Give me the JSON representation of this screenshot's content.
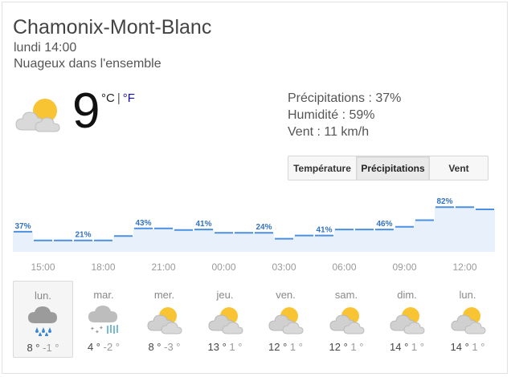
{
  "location": {
    "name": "Chamonix-Mont-Blanc",
    "time": "lundi 14:00",
    "condition": "Nuageux dans l'ensemble"
  },
  "current": {
    "icon": "partly-cloudy-icon",
    "temp": "9",
    "unit_c": "°C",
    "unit_sep": "|",
    "unit_f": "°F"
  },
  "details": {
    "precip": "Précipitations : 37%",
    "humidity": "Humidité : 59%",
    "wind": "Vent : 11 km/h"
  },
  "tabs": [
    {
      "label": "Température",
      "active": false
    },
    {
      "label": "Précipitations",
      "active": true
    },
    {
      "label": "Vent",
      "active": false
    }
  ],
  "colors": {
    "line": "#4a90e2",
    "fill": "#e8f1fb",
    "label": "#3372c2",
    "axis": "#9a9a9a"
  },
  "chart_data": {
    "type": "area",
    "ylabel": "Précipitations (%)",
    "x": [
      "14:00",
      "15:00",
      "16:00",
      "17:00",
      "18:00",
      "19:00",
      "20:00",
      "21:00",
      "22:00",
      "23:00",
      "00:00",
      "01:00",
      "02:00",
      "03:00",
      "04:00",
      "05:00",
      "06:00",
      "07:00",
      "08:00",
      "09:00",
      "10:00",
      "11:00",
      "12:00",
      "13:00"
    ],
    "values": [
      37,
      21,
      21,
      21,
      21,
      29,
      43,
      43,
      40,
      41,
      35,
      35,
      35,
      24,
      30,
      30,
      41,
      41,
      41,
      46,
      58,
      82,
      82,
      78
    ],
    "labeled_points": [
      {
        "index": 0,
        "text": "37%"
      },
      {
        "index": 3,
        "text": "21%"
      },
      {
        "index": 6,
        "text": "43%"
      },
      {
        "index": 9,
        "text": "41%"
      },
      {
        "index": 12,
        "text": "24%"
      },
      {
        "index": 15,
        "text": "41%"
      },
      {
        "index": 18,
        "text": "46%"
      },
      {
        "index": 21,
        "text": "82%"
      }
    ],
    "tick_labels": [
      "15:00",
      "18:00",
      "21:00",
      "00:00",
      "03:00",
      "06:00",
      "09:00",
      "12:00"
    ],
    "ylim": [
      0,
      100
    ]
  },
  "forecast": [
    {
      "day": "lun.",
      "icon": "rain-icon",
      "hi": "8 °",
      "lo": "-1 °",
      "selected": true
    },
    {
      "day": "mar.",
      "icon": "rain-snow-icon",
      "hi": "4 °",
      "lo": "-2 °",
      "selected": false
    },
    {
      "day": "mer.",
      "icon": "partly-cloudy-icon",
      "hi": "8 °",
      "lo": "-3 °",
      "selected": false
    },
    {
      "day": "jeu.",
      "icon": "partly-cloudy-icon",
      "hi": "13 °",
      "lo": "1 °",
      "selected": false
    },
    {
      "day": "ven.",
      "icon": "partly-cloudy-icon",
      "hi": "12 °",
      "lo": "1 °",
      "selected": false
    },
    {
      "day": "sam.",
      "icon": "partly-cloudy-icon",
      "hi": "12 °",
      "lo": "1 °",
      "selected": false
    },
    {
      "day": "dim.",
      "icon": "partly-cloudy-icon",
      "hi": "14 °",
      "lo": "1 °",
      "selected": false
    },
    {
      "day": "lun.",
      "icon": "partly-cloudy-icon",
      "hi": "14 °",
      "lo": "1 °",
      "selected": false
    }
  ]
}
